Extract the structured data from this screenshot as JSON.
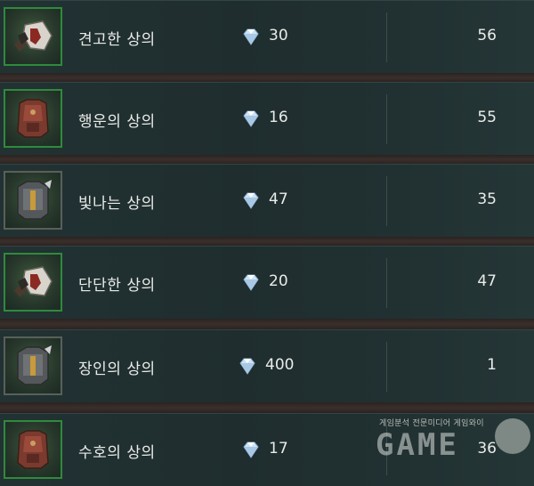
{
  "items": [
    {
      "name": "견고한 상의",
      "price": "30",
      "count": "56",
      "icon": "sturdy-top-icon"
    },
    {
      "name": "행운의 상의",
      "price": "16",
      "count": "55",
      "icon": "lucky-top-icon"
    },
    {
      "name": "빛나는 상의",
      "price": "47",
      "count": "35",
      "icon": "shining-top-icon"
    },
    {
      "name": "단단한 상의",
      "price": "20",
      "count": "47",
      "icon": "solid-top-icon"
    },
    {
      "name": "장인의 상의",
      "price": "400",
      "count": "1",
      "icon": "artisan-top-icon"
    },
    {
      "name": "수호의 상의",
      "price": "17",
      "count": "36",
      "icon": "guardian-top-icon"
    }
  ],
  "currency_icon": "diamond-icon",
  "watermark": {
    "caption": "게임분석 전문미디어 게임와이",
    "logo": "GAME"
  },
  "colors": {
    "frame": "#2f8a3c",
    "text": "#e9ece8",
    "row_bg": "#1f2d2e",
    "gap_bg": "#3a2f2b"
  }
}
